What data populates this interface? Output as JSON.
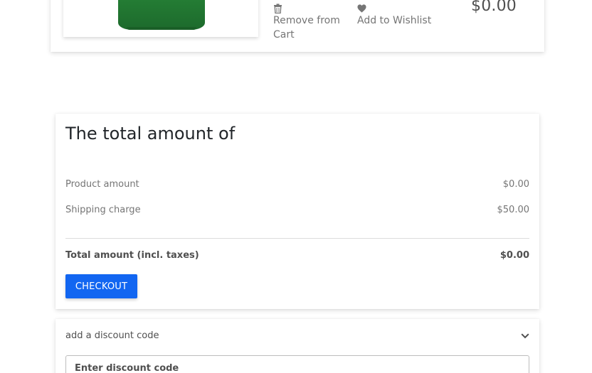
{
  "cart_item": {
    "remove_label": "Remove from Cart",
    "wishlist_label": "Add to Wishlist",
    "price": "$0.00"
  },
  "summary": {
    "title": "The total amount of",
    "product_amount_label": "Product amount",
    "product_amount_value": "$0.00",
    "shipping_label": "Shipping charge",
    "shipping_value": "$50.00",
    "total_label": "Total amount (incl. taxes)",
    "total_value": "$0.00",
    "checkout_label": "CHECKOUT"
  },
  "discount": {
    "toggle_label": "add a discount code",
    "input_placeholder": "Enter discount code"
  },
  "colors": {
    "primary": "#1266f1",
    "product_green": "#237a33"
  }
}
